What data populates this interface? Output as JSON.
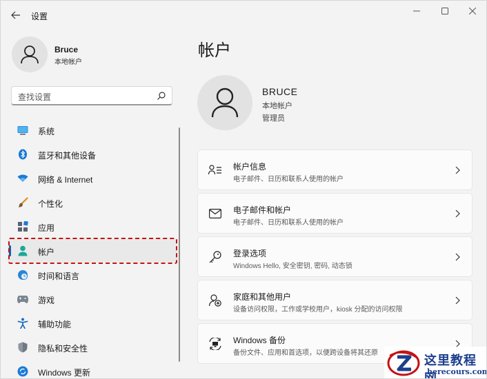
{
  "window": {
    "title": "设置"
  },
  "profile": {
    "name": "Bruce",
    "subtitle": "本地帐户"
  },
  "search": {
    "placeholder": "查找设置"
  },
  "sidebar": {
    "items": [
      {
        "label": "系统",
        "icon": "monitor-icon"
      },
      {
        "label": "蓝牙和其他设备",
        "icon": "bluetooth-icon"
      },
      {
        "label": "网络 & Internet",
        "icon": "wifi-icon"
      },
      {
        "label": "个性化",
        "icon": "brush-icon"
      },
      {
        "label": "应用",
        "icon": "apps-icon"
      },
      {
        "label": "帐户",
        "icon": "person-icon",
        "active": true
      },
      {
        "label": "时间和语言",
        "icon": "globe-clock-icon"
      },
      {
        "label": "游戏",
        "icon": "gamepad-icon"
      },
      {
        "label": "辅助功能",
        "icon": "accessibility-icon"
      },
      {
        "label": "隐私和安全性",
        "icon": "shield-icon"
      },
      {
        "label": "Windows 更新",
        "icon": "update-icon"
      }
    ]
  },
  "main": {
    "title": "帐户",
    "account": {
      "name": "BRUCE",
      "type": "本地帐户",
      "role": "管理员"
    },
    "cards": [
      {
        "title": "帐户信息",
        "desc": "电子邮件、日历和联系人使用的帐户",
        "icon": "account-info-icon"
      },
      {
        "title": "电子邮件和帐户",
        "desc": "电子邮件、日历和联系人使用的帐户",
        "icon": "mail-icon"
      },
      {
        "title": "登录选项",
        "desc": "Windows Hello, 安全密钥, 密码, 动态锁",
        "icon": "key-icon"
      },
      {
        "title": "家庭和其他用户",
        "desc": "设备访问权限，工作或学校用户，kiosk 分配的访问权限",
        "icon": "add-user-icon"
      },
      {
        "title": "Windows 备份",
        "desc": "备份文件、应用和首选项，以便跨设备将其还原",
        "icon": "backup-icon"
      }
    ]
  },
  "watermark": {
    "site_name": "这里教程网",
    "site_url": "herecours.com"
  },
  "colors": {
    "accent": "#0067c0",
    "highlight_border": "#c41212",
    "watermark": "#1c3e8c"
  }
}
